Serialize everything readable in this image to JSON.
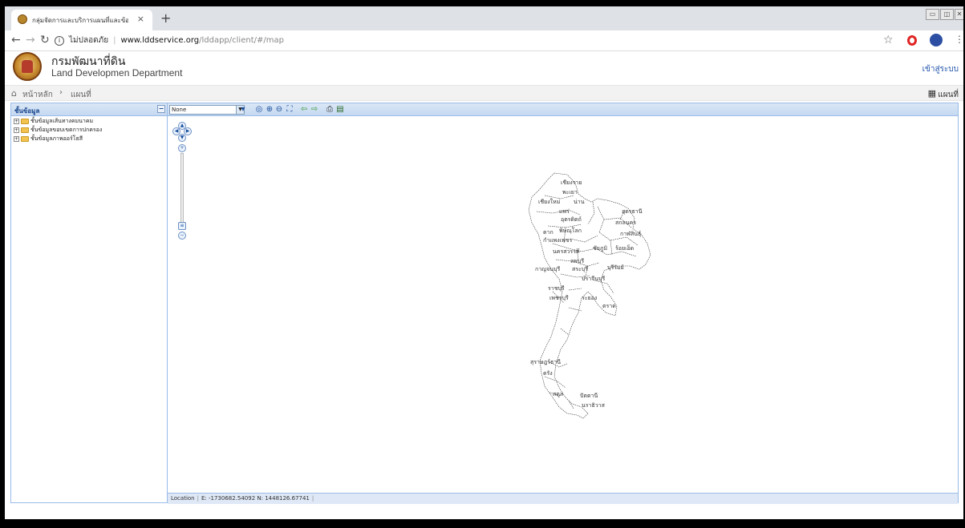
{
  "browser": {
    "tab_title": "กลุ่มจัดการและบริการแผนที่และข้อมูล",
    "tab_close": "×",
    "new_tab": "+",
    "url_security": "ไม่ปลอดภัย",
    "url_host": "www.lddservice.org",
    "url_path": "/lddapp/client/#/map"
  },
  "site": {
    "title_th": "กรมพัฒนาที่ดิน",
    "title_en": "Land Developmen Department",
    "login": "เข้าสู่ระบบ"
  },
  "breadcrumb": {
    "home": "หน้าหลัก",
    "separator": "›",
    "current": "แผนที่",
    "map_tab": "แผนที่"
  },
  "layers_panel": {
    "title": "ชั้นข้อมูล",
    "items": [
      {
        "label": "ชั้นข้อมูลเส้นทางคมนาคม"
      },
      {
        "label": "ชั้นข้อมูลขอบเขตการปกครอง"
      },
      {
        "label": "ชั้นข้อมูลภาพออร์โธสี"
      }
    ]
  },
  "map": {
    "layer_select": "None",
    "status_label": "Location",
    "status_coords": "E: -1730682.54092  N: 1448126.67741",
    "provinces": [
      "เชียงราย",
      "พะเยา",
      "เชียงใหม่",
      "น่าน",
      "แพร่",
      "อุตรดิตถ์",
      "อุดรธานี",
      "สกลนคร",
      "ตาก",
      "พิษณุโลก",
      "กาฬสินธุ์",
      "กำแพงเพชร",
      "ชัยภูมิ",
      "ร้อยเอ็ด",
      "นครสวรรค์",
      "ลพบุรี",
      "กาญจนบุรี",
      "สระบุรี",
      "บุรีรัมย์",
      "ปราจีนบุรี",
      "ราชบุรี",
      "เพชรบุรี",
      "ระยอง",
      "ตราด",
      "สุราษฎร์ธานี",
      "ตรัง",
      "สตูล",
      "ปัตตานี",
      "นราธิวาส"
    ]
  },
  "colors": {
    "panel_header": "#c6d9f1",
    "panel_border": "#99bbe8",
    "link_blue": "#2255aa"
  }
}
